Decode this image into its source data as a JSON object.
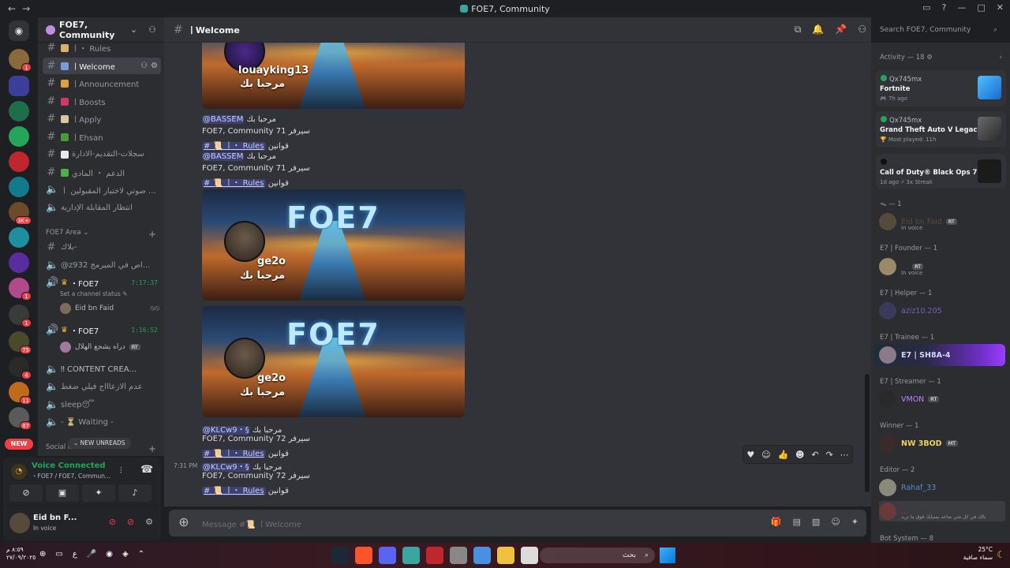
{
  "window": {
    "title": "FOE7, Community"
  },
  "guild": {
    "name": "FOE7, Community",
    "invite_icon": "add-member-icon"
  },
  "channels": [
    {
      "name": "ㅣ・ Rules",
      "type": "text"
    },
    {
      "name": "ㅣWelcome",
      "type": "text",
      "active": true
    },
    {
      "name": "ㅣAnnouncement",
      "type": "text"
    },
    {
      "name": "ㅣBoosts",
      "type": "text"
    },
    {
      "name": "ㅣApply",
      "type": "text"
    },
    {
      "name": "ㅣEhsan",
      "type": "text"
    },
    {
      "name": "سجلات-التقديم-الادارة",
      "type": "text"
    },
    {
      "name": "الدعم ・ المادي",
      "type": "text"
    },
    {
      "name": "ㅣ صوتي لاختبار المقبولين ...",
      "type": "voice"
    },
    {
      "name": "انتظار المقابلة الإدارية",
      "type": "voice"
    }
  ],
  "category_foe7": {
    "label": "FOE7 Area",
    "channels": [
      {
        "name": "بلاك-",
        "type": "text"
      },
      {
        "name": "@z932 اص في المبرمج...",
        "type": "voice"
      },
      {
        "name": "・FOE7",
        "type": "voice",
        "timer": "7:17:37",
        "status": "Set a channel status"
      },
      {
        "name": "・FOE7",
        "type": "voice",
        "timer": "1:16:52"
      },
      {
        "name": "‼ CONTENT CREA...",
        "type": "voice"
      },
      {
        "name": "عدم الازعاااج فيلي ضغط",
        "type": "voice"
      },
      {
        "name": "sleep😴",
        "type": "voice"
      },
      {
        "name": "- ⏳ Waiting -",
        "type": "voice"
      }
    ],
    "voice_users": [
      {
        "name": "Eid bn Faid"
      },
      {
        "name": "دراه يشجع الهلال",
        "tag": "RT"
      }
    ]
  },
  "category_social": {
    "label": "Social m"
  },
  "new_unreads": "NEW UNREADS",
  "server_rail": {
    "new_label": "NEW",
    "badges": [
      "1",
      "3K+",
      "1",
      "1",
      "1",
      "75",
      "4",
      "11",
      "87"
    ]
  },
  "voice_panel": {
    "status": "Voice Connected",
    "channel": "・FOE7 / FOE7, Commun..."
  },
  "user_panel": {
    "name": "Eid bn F...",
    "status": "In voice"
  },
  "chat": {
    "channel_name": "ㅣWelcome",
    "messages": [
      {
        "banner_name": "louayking13",
        "banner_welcome": "مرحبا بك"
      },
      {
        "mention": "@BASSEM",
        "greet": "مرحبا بك",
        "server_line": "FOE7, Community 71 سيرفر",
        "rules_prefix": "قوانين",
        "rules_link": "# 📜 ㅣ・ Rules"
      },
      {
        "mention": "@BASSEM",
        "greet": "مرحبا بك",
        "server_line": "FOE7, Community 71 سيرفر",
        "rules_prefix": "قوانين",
        "rules_link": "# 📜 ㅣ・ Rules"
      },
      {
        "banner_logo": "FOE7",
        "banner_name": "ge2o",
        "banner_welcome": "مرحبا بك"
      },
      {
        "banner_logo": "FOE7",
        "banner_name": "ge2o",
        "banner_welcome": "مرحبا بك"
      },
      {
        "mention": "@KLCw9・§",
        "greet": "مرحبا بك",
        "server_line": "FOE7, Community 72 سيرفر",
        "rules_prefix": "قوانين",
        "rules_link": "# 📜 ㅣ・ Rules"
      },
      {
        "timestamp": "7:31 PM",
        "mention": "@KLCw9・§",
        "greet": "مرحبا بك",
        "server_line": "FOE7, Community 72 سيرفر",
        "rules_prefix": "قوانين",
        "rules_link": "# 📜 ㅣ・ Rules"
      }
    ],
    "composer_placeholder": "Message #📜 ㅣWelcome"
  },
  "search": {
    "placeholder": "Search FOE7, Community"
  },
  "members": {
    "activity_header": "Activity — 18",
    "activities": [
      {
        "user": "Qx745mx",
        "game": "Fortnite",
        "detail": "7h ago"
      },
      {
        "user": "Qx745mx",
        "game": "Grand Theft Auto V Legacy",
        "detail": "Most played: 11h"
      },
      {
        "user": "",
        "game": "Call of Duty® Black Ops 7",
        "detail": "1d ago  ⚡ 3x Streak"
      }
    ],
    "roles": [
      {
        "label": "ᯓ — 1",
        "members": [
          {
            "name": "Eid bn Faid",
            "status": "In voice",
            "tag": "RT"
          }
        ]
      },
      {
        "label": "E7 | Founder — 1",
        "members": [
          {
            "name": "...",
            "status": "In voice",
            "tag": "RT"
          }
        ]
      },
      {
        "label": "E7 | Helper — 1",
        "members": [
          {
            "name": "aziz10.205"
          }
        ]
      },
      {
        "label": "E7 | Trainee — 1",
        "members": [
          {
            "name": "E7 | SH8A-4"
          }
        ]
      },
      {
        "label": "E7 | Streamer — 1",
        "members": [
          {
            "name": "VMON",
            "tag": "RT"
          }
        ]
      },
      {
        "label": "Winner — 1",
        "members": [
          {
            "name": "NW 3BOD",
            "tag": "MT"
          }
        ]
      },
      {
        "label": "Editor — 2",
        "members": [
          {
            "name": "Rahaf_33"
          },
          {
            "name": "...",
            "status": "بالك في كل شي ضاعه بسبابك فوق ما تريد"
          }
        ]
      },
      {
        "label": "Bot System — 8"
      }
    ]
  },
  "taskbar": {
    "time": "٨:٥٩ م",
    "date": "٢٧/٠٩/٢٠٢٥",
    "lang": "ع",
    "search_placeholder": "بحث",
    "weather_temp": "25°C",
    "weather_desc": "سماء صافية"
  }
}
